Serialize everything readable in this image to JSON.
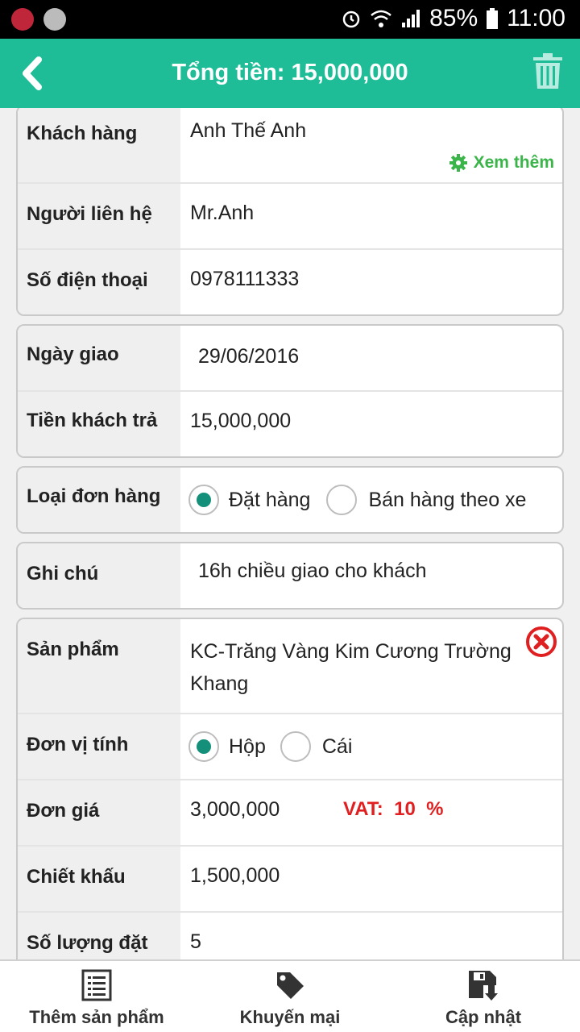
{
  "statusbar": {
    "battery": "85%",
    "time": "11:00"
  },
  "header": {
    "title": "Tổng tiền: 15,000,000"
  },
  "customer": {
    "customer_label": "Khách hàng",
    "customer_value": "Anh Thế Anh",
    "see_more": "Xem thêm",
    "contact_label": "Người liên hệ",
    "contact_value": "Mr.Anh",
    "phone_label": "Số điện thoại",
    "phone_value": "0978111333"
  },
  "delivery": {
    "date_label": "Ngày giao",
    "date_value": "29/06/2016",
    "paid_label": "Tiền khách trả",
    "paid_value": "15,000,000"
  },
  "order_type": {
    "label": "Loại đơn hàng",
    "options": [
      "Đặt hàng",
      "Bán hàng theo xe"
    ],
    "selected": "Đặt hàng"
  },
  "note": {
    "label": "Ghi chú",
    "value": "16h chiều giao cho khách"
  },
  "product": {
    "product_label": "Sản phẩm",
    "product_value": "KC-Trăng Vàng Kim Cương Trường Khang",
    "unit_label": "Đơn vị tính",
    "unit_options": [
      "Hộp",
      "Cái"
    ],
    "unit_selected": "Hộp",
    "price_label": "Đơn giá",
    "price_value": "3,000,000",
    "vat_text": "VAT:  10  %",
    "discount_label": "Chiết khấu",
    "discount_value": "1,500,000",
    "qty_label": "Số lượng đặt",
    "qty_value": "5"
  },
  "bottom_nav": {
    "add_product": "Thêm sản phẩm",
    "promotion": "Khuyến mại",
    "update": "Cập nhật"
  },
  "colors": {
    "primary": "#1ebd98",
    "radio": "#138f7a",
    "see_more": "#3bb54a",
    "vat": "#e02020",
    "remove": "#e02020"
  }
}
